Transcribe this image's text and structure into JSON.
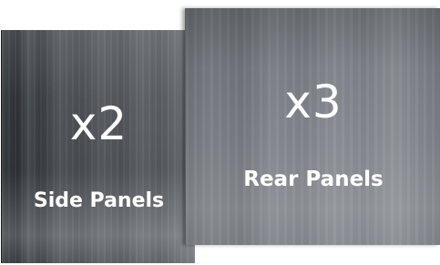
{
  "panels": {
    "side": {
      "count": "x2",
      "label": "Side Panels"
    },
    "rear": {
      "count": "x3",
      "label": "Rear Panels"
    }
  },
  "colors": {
    "text": "#ffffff",
    "side_panel_dark": "#3d4247",
    "rear_panel": "#7c8086",
    "background": "#ffffff"
  }
}
